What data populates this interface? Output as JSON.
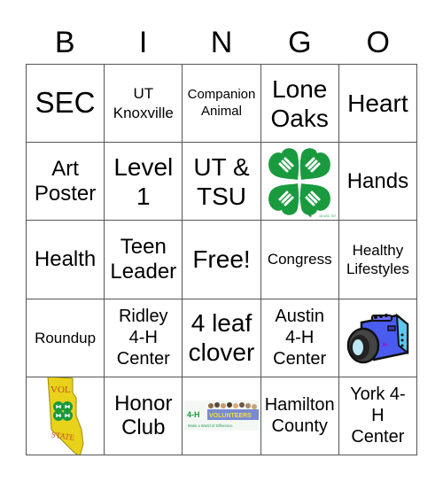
{
  "card": {
    "header_letters": [
      "B",
      "I",
      "N",
      "G",
      "O"
    ],
    "rows": [
      [
        {
          "type": "text",
          "text": "SEC"
        },
        {
          "type": "text",
          "text": "UT\nKnoxville"
        },
        {
          "type": "text",
          "text": "Companion\nAnimal"
        },
        {
          "type": "text",
          "text": "Lone\nOaks"
        },
        {
          "type": "text",
          "text": "Heart"
        }
      ],
      [
        {
          "type": "text",
          "text": "Art\nPoster"
        },
        {
          "type": "text",
          "text": "Level\n1"
        },
        {
          "type": "text",
          "text": "UT &\nTSU"
        },
        {
          "type": "image",
          "icon": "4h-clover-emblem-icon"
        },
        {
          "type": "text",
          "text": "Hands"
        }
      ],
      [
        {
          "type": "text",
          "text": "Health"
        },
        {
          "type": "text",
          "text": "Teen\nLeader"
        },
        {
          "type": "text",
          "text": "Free!"
        },
        {
          "type": "text",
          "text": "Congress"
        },
        {
          "type": "text",
          "text": "Healthy\nLifestyles"
        }
      ],
      [
        {
          "type": "text",
          "text": "Roundup"
        },
        {
          "type": "text",
          "text": "Ridley\n4-H\nCenter"
        },
        {
          "type": "text",
          "text": "4 leaf\nclover"
        },
        {
          "type": "text",
          "text": "Austin\n4-H\nCenter"
        },
        {
          "type": "image",
          "icon": "camera-icon"
        }
      ],
      [
        {
          "type": "image",
          "icon": "vol-state-4h-emblem-icon",
          "image_text": [
            "VOL",
            "STATE"
          ]
        },
        {
          "type": "text",
          "text": "Honor\nClub"
        },
        {
          "type": "image",
          "icon": "4h-volunteers-banner-icon",
          "image_text": [
            "4-H",
            "VOLUNTEERS",
            "Make a World of Difference"
          ]
        },
        {
          "type": "text",
          "text": "Hamilton\nCounty"
        },
        {
          "type": "text",
          "text": "York 4-\nH\nCenter"
        }
      ]
    ]
  },
  "colors": {
    "clover_green": "#1a9a3e",
    "vol_state_yellow": "#e8d21a",
    "vol_state_red": "#c8452a",
    "camera_blue": "#4a5cf0",
    "grid_line": "#555555"
  }
}
